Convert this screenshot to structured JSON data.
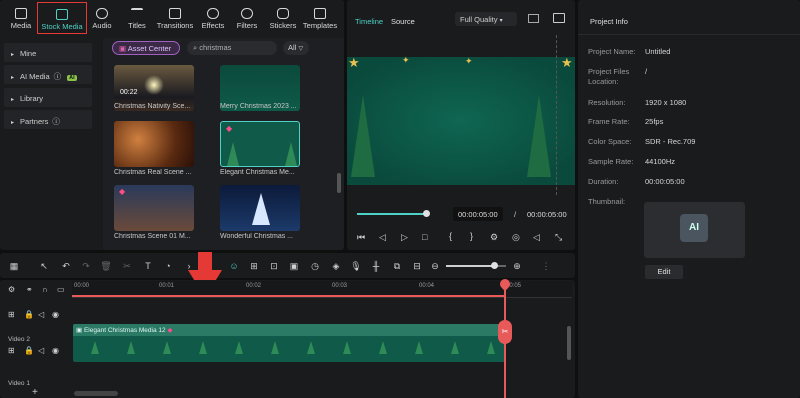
{
  "toolbar": {
    "tabs": [
      {
        "label": "Media",
        "icon": "media-icon"
      },
      {
        "label": "Stock Media",
        "icon": "stock-media-icon"
      },
      {
        "label": "Audio",
        "icon": "audio-icon"
      },
      {
        "label": "Titles",
        "icon": "titles-icon"
      },
      {
        "label": "Transitions",
        "icon": "transitions-icon"
      },
      {
        "label": "Effects",
        "icon": "effects-icon"
      },
      {
        "label": "Filters",
        "icon": "filters-icon"
      },
      {
        "label": "Stickers",
        "icon": "stickers-icon"
      },
      {
        "label": "Templates",
        "icon": "templates-icon"
      }
    ]
  },
  "sidebar": {
    "items": [
      {
        "label": "Mine"
      },
      {
        "label": "AI Media",
        "badge": "AI"
      },
      {
        "label": "Library"
      },
      {
        "label": "Partners"
      }
    ]
  },
  "library": {
    "asset_center": "Asset Center",
    "search_value": "christmas",
    "filter_label": "All",
    "items": [
      {
        "title": "Christmas Nativity Sce...",
        "duration": "00:22"
      },
      {
        "title": "Merry Christmas 2023 ..."
      },
      {
        "title": "Christmas Real Scene ..."
      },
      {
        "title": "Elegant Christmas Me..."
      },
      {
        "title": "Christmas Scene 01 M..."
      },
      {
        "title": "Wonderful Christmas ..."
      }
    ]
  },
  "player": {
    "tab_timeline": "Timeline",
    "tab_source": "Source",
    "quality": "Full Quality",
    "current_time": "00:00:05:00",
    "separator": "/",
    "total_time": "00:00:05:00",
    "progress": 0.7
  },
  "project_info": {
    "title": "Project Info",
    "rows": [
      {
        "label": "Project Name:",
        "value": "Untitled"
      },
      {
        "label": "Project Files Location:",
        "value": "/"
      },
      {
        "label": "Resolution:",
        "value": "1920 x 1080"
      },
      {
        "label": "Frame Rate:",
        "value": "25fps"
      },
      {
        "label": "Color Space:",
        "value": "SDR - Rec.709"
      },
      {
        "label": "Sample Rate:",
        "value": "44100Hz"
      },
      {
        "label": "Duration:",
        "value": "00:00:05:00"
      }
    ],
    "thumbnail_label": "Thumbnail:",
    "edit_label": "Edit"
  },
  "timeline": {
    "ticks": [
      "00:00",
      "00:01",
      "00:02",
      "00:03",
      "00:04",
      "00:05"
    ],
    "clip_name": "Elegant Christmas Media 12",
    "track2_label": "Video 2",
    "track1_label": "Video 1",
    "zoom": 0.8
  },
  "colors": {
    "accent": "#4fd1c5",
    "highlight_box": "#e53935",
    "clip": "#2a7a66",
    "playhead": "#e85a5a",
    "arrow": "#e53935"
  }
}
